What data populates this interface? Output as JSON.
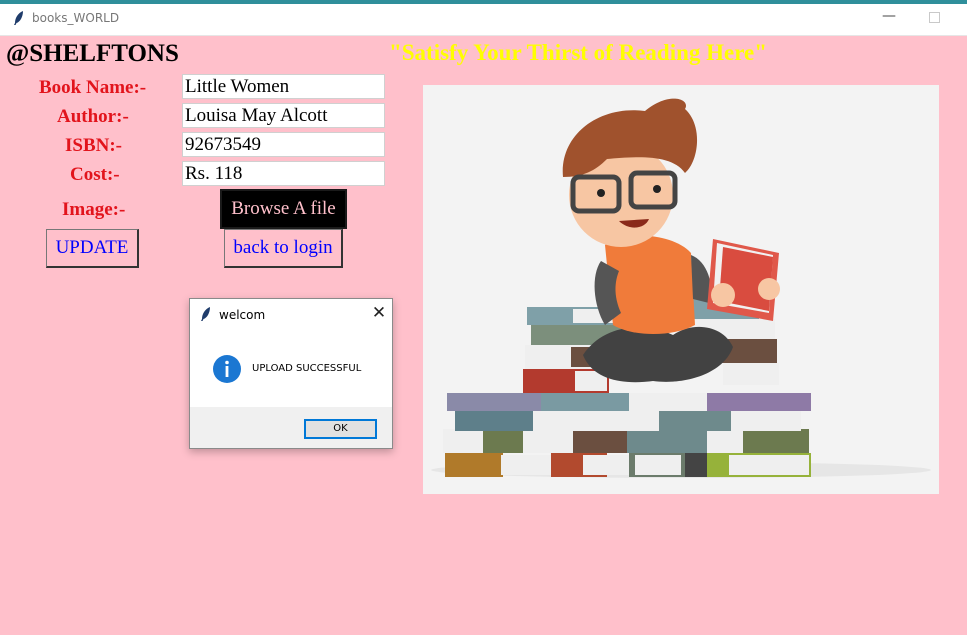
{
  "window": {
    "title": "books_WORLD",
    "minimize_glyph": "—"
  },
  "header": {
    "brand": "@SHELFTONS",
    "slogan": "\"Satisfy Your Thirst of Reading Here\""
  },
  "form": {
    "book_name_label": "Book Name:-",
    "author_label": "Author:-",
    "isbn_label": "ISBN:-",
    "cost_label": "Cost:-",
    "image_label": "Image:-",
    "book_name_value": "Little Women",
    "author_value": "Louisa May Alcott",
    "isbn_value": "92673549",
    "cost_value": "Rs. 118",
    "browse_label": "Browse A file",
    "update_label": "UPDATE",
    "back_label": "back to login"
  },
  "dialog": {
    "title": "welcom",
    "message": "UPLOAD SUCCESSFUL",
    "ok_label": "OK",
    "close_glyph": "✕",
    "icon": "info-icon"
  },
  "illustration": {
    "subject": "boy-reading-on-books-illustration"
  },
  "colors": {
    "background": "#ffc0cb",
    "label_red": "#e2141c",
    "slogan_yellow": "#ffff00",
    "button_text_blue": "#0000ff",
    "browse_bg": "#000000",
    "dialog_accent": "#0078d7"
  }
}
